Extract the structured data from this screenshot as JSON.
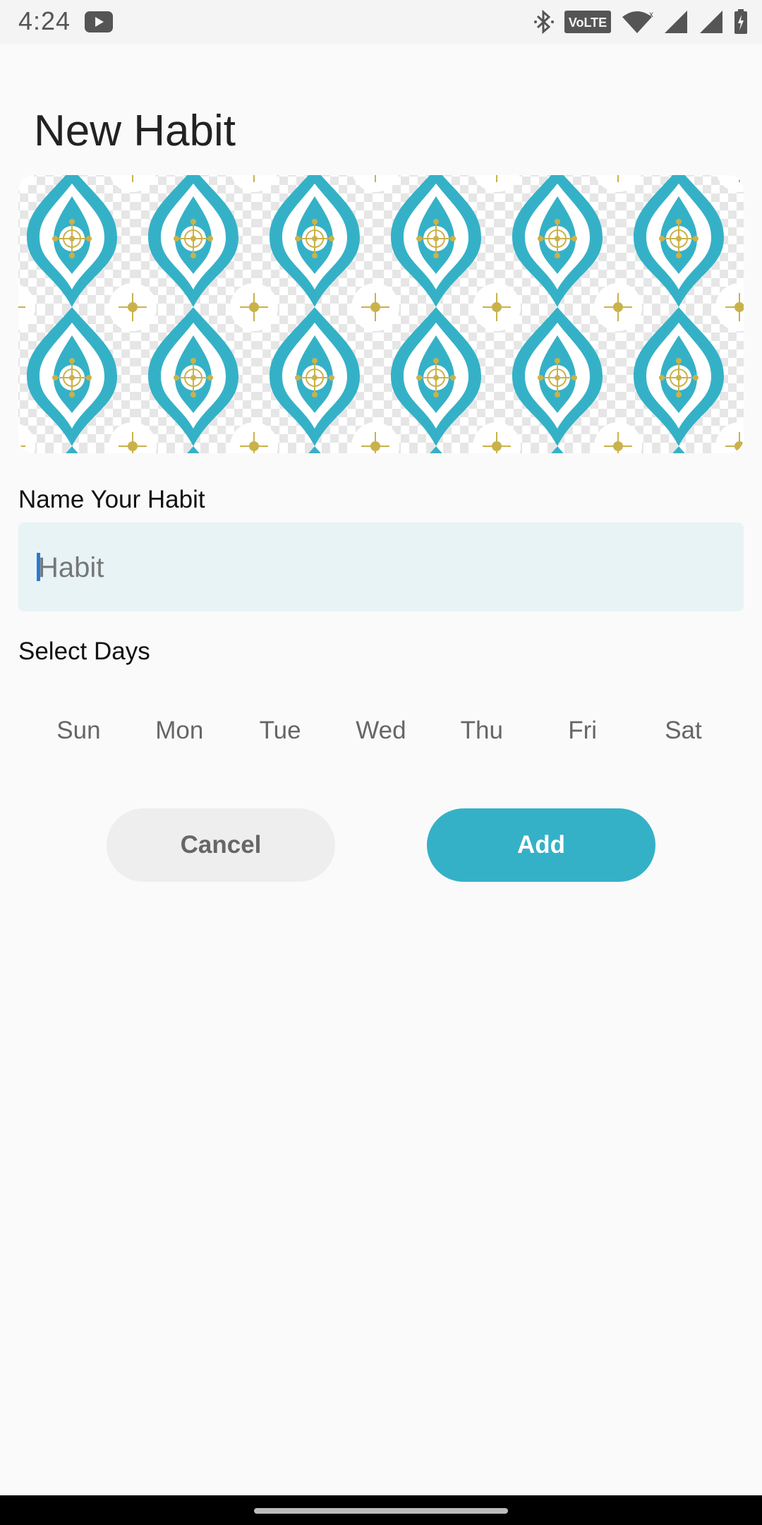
{
  "status_bar": {
    "time": "4:24",
    "network_label": "VoLTE",
    "icons": [
      "youtube-icon",
      "bluetooth-icon",
      "volte-icon",
      "wifi-icon",
      "signal-icon",
      "signal-icon",
      "battery-icon"
    ]
  },
  "page": {
    "title": "New Habit"
  },
  "banner": {
    "icon": "damask-pattern-image",
    "colors": {
      "teal": "#35b1c7",
      "gold": "#c9b24a",
      "background": "#ffffff"
    }
  },
  "form": {
    "name_label": "Name Your Habit",
    "habit_input": {
      "value": "",
      "placeholder": "Habit"
    },
    "days_label": "Select Days",
    "days": [
      "Sun",
      "Mon",
      "Tue",
      "Wed",
      "Thu",
      "Fri",
      "Sat"
    ]
  },
  "actions": {
    "cancel_label": "Cancel",
    "add_label": "Add"
  },
  "colors": {
    "accent": "#35b1c7",
    "input_background": "#e8f3f6",
    "cancel_background": "#eeeeee"
  }
}
